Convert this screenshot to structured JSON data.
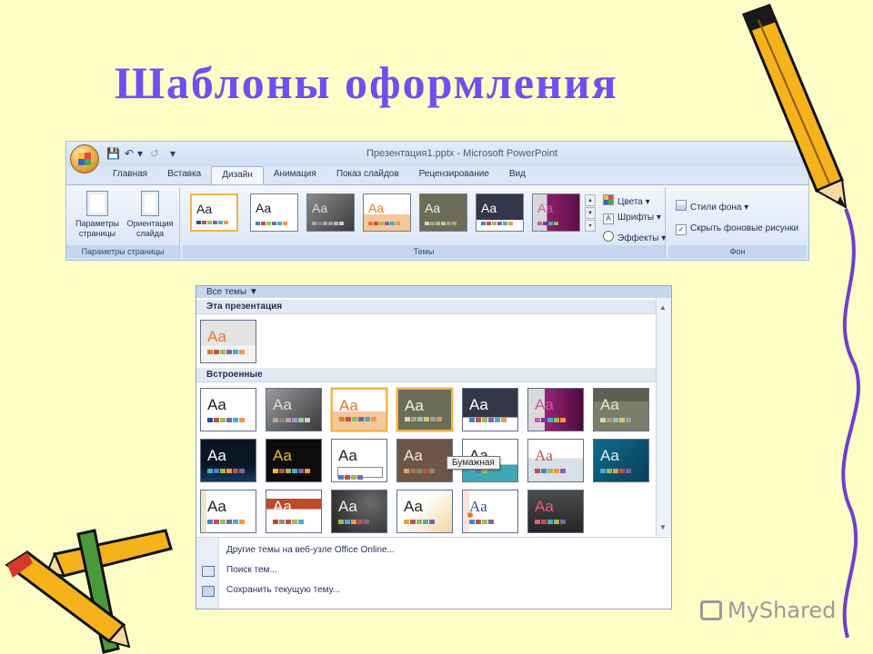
{
  "slide_title": "Шаблоны оформления",
  "window": {
    "title": "Презентация1.pptx - Microsoft PowerPoint"
  },
  "tabs": [
    "Главная",
    "Вставка",
    "Дизайн",
    "Анимация",
    "Показ слайдов",
    "Рецензирование",
    "Вид"
  ],
  "active_tab": "Дизайн",
  "ribbon": {
    "page_setup_label": "Параметры\nстраницы",
    "orientation_label": "Ориентация\nслайда",
    "page_setup_group": "Параметры страницы",
    "themes_group": "Темы",
    "colors_label": "Цвета",
    "fonts_label": "Шрифты",
    "effects_label": "Эффекты",
    "bg_styles_label": "Стили фона",
    "hide_bg_label": "Скрыть фоновые рисунки",
    "bg_group": "Фон"
  },
  "gallery": {
    "header": "Все темы",
    "this_presentation": "Эта презентация",
    "builtin": "Встроенные",
    "tooltip": "Бумажная",
    "more_online": "Другие темы на веб-узле Office Online...",
    "search_themes": "Поиск тем...",
    "save_theme": "Сохранить текущую тему..."
  },
  "theme_glyph": "Aa",
  "watermark": "MyShared",
  "colors": {
    "title": "#6f4ff2",
    "background": "#fdfdc6",
    "selection": "#f0b34c"
  }
}
